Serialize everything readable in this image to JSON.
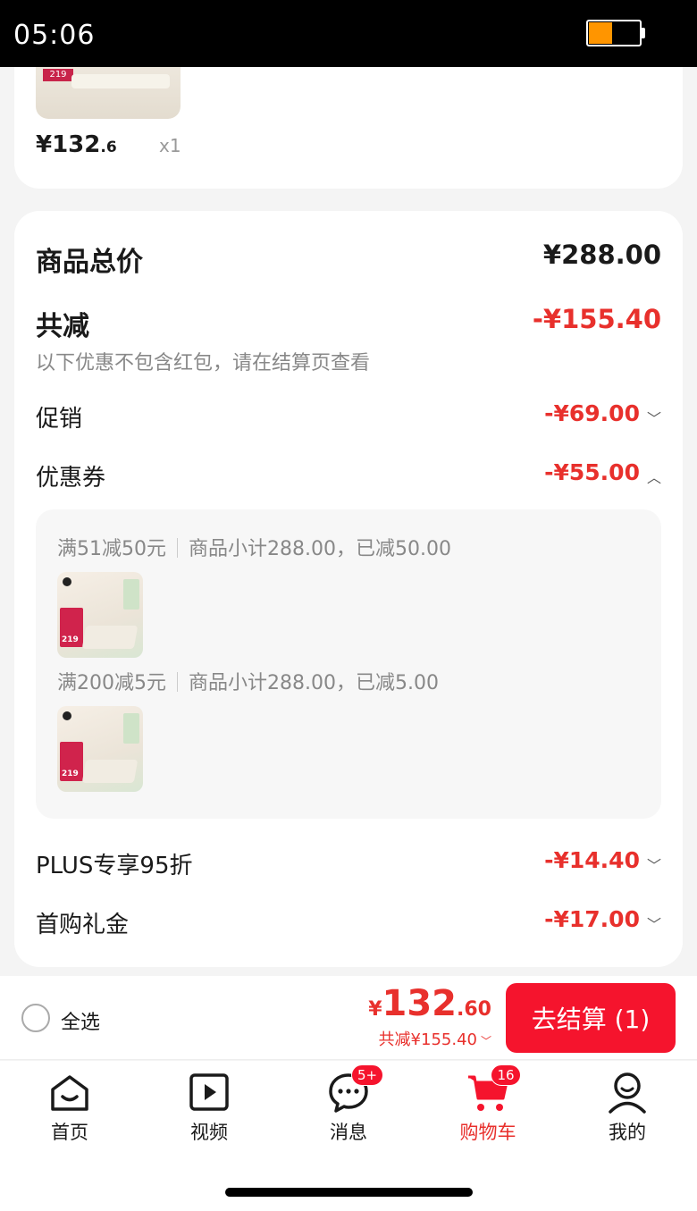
{
  "status_bar": {
    "time": "05:06"
  },
  "top_item": {
    "thumb_tag": "219",
    "price_main": "¥132",
    "price_decimal": ".6",
    "quantity": "x1"
  },
  "summary": {
    "total_label": "商品总价",
    "total_value": "¥288.00",
    "reduce_label": "共减",
    "reduce_value": "-¥155.40",
    "reduce_note": "以下优惠不包含红包，请在结算页查看",
    "promo_label": "促销",
    "promo_value": "-¥69.00",
    "coupon_label": "优惠券",
    "coupon_value": "-¥55.00",
    "coupons": [
      {
        "rule": "满51减50元",
        "detail": "商品小计288.00，已减50.00",
        "thumb_price": "219"
      },
      {
        "rule": "满200减5元",
        "detail": "商品小计288.00，已减5.00",
        "thumb_price": "219"
      }
    ],
    "plus_label": "PLUS专享95折",
    "plus_value": "-¥14.40",
    "firstbuy_label": "首购礼金",
    "firstbuy_value": "-¥17.00"
  },
  "bottom_bar": {
    "select_all": "全选",
    "total_yen": "¥",
    "total_int": "132",
    "total_dec": ".60",
    "total_reduce": "共减¥155.40",
    "checkout_label": "去结算 (1)"
  },
  "tabbar": {
    "items": [
      {
        "label": "首页",
        "icon": "home-icon"
      },
      {
        "label": "视频",
        "icon": "video-icon"
      },
      {
        "label": "消息",
        "icon": "message-icon",
        "badge": "5+"
      },
      {
        "label": "购物车",
        "icon": "cart-icon",
        "badge": "16",
        "active": true
      },
      {
        "label": "我的",
        "icon": "profile-icon"
      }
    ]
  },
  "colors": {
    "accent": "#e8302c",
    "button": "#f5142d"
  }
}
